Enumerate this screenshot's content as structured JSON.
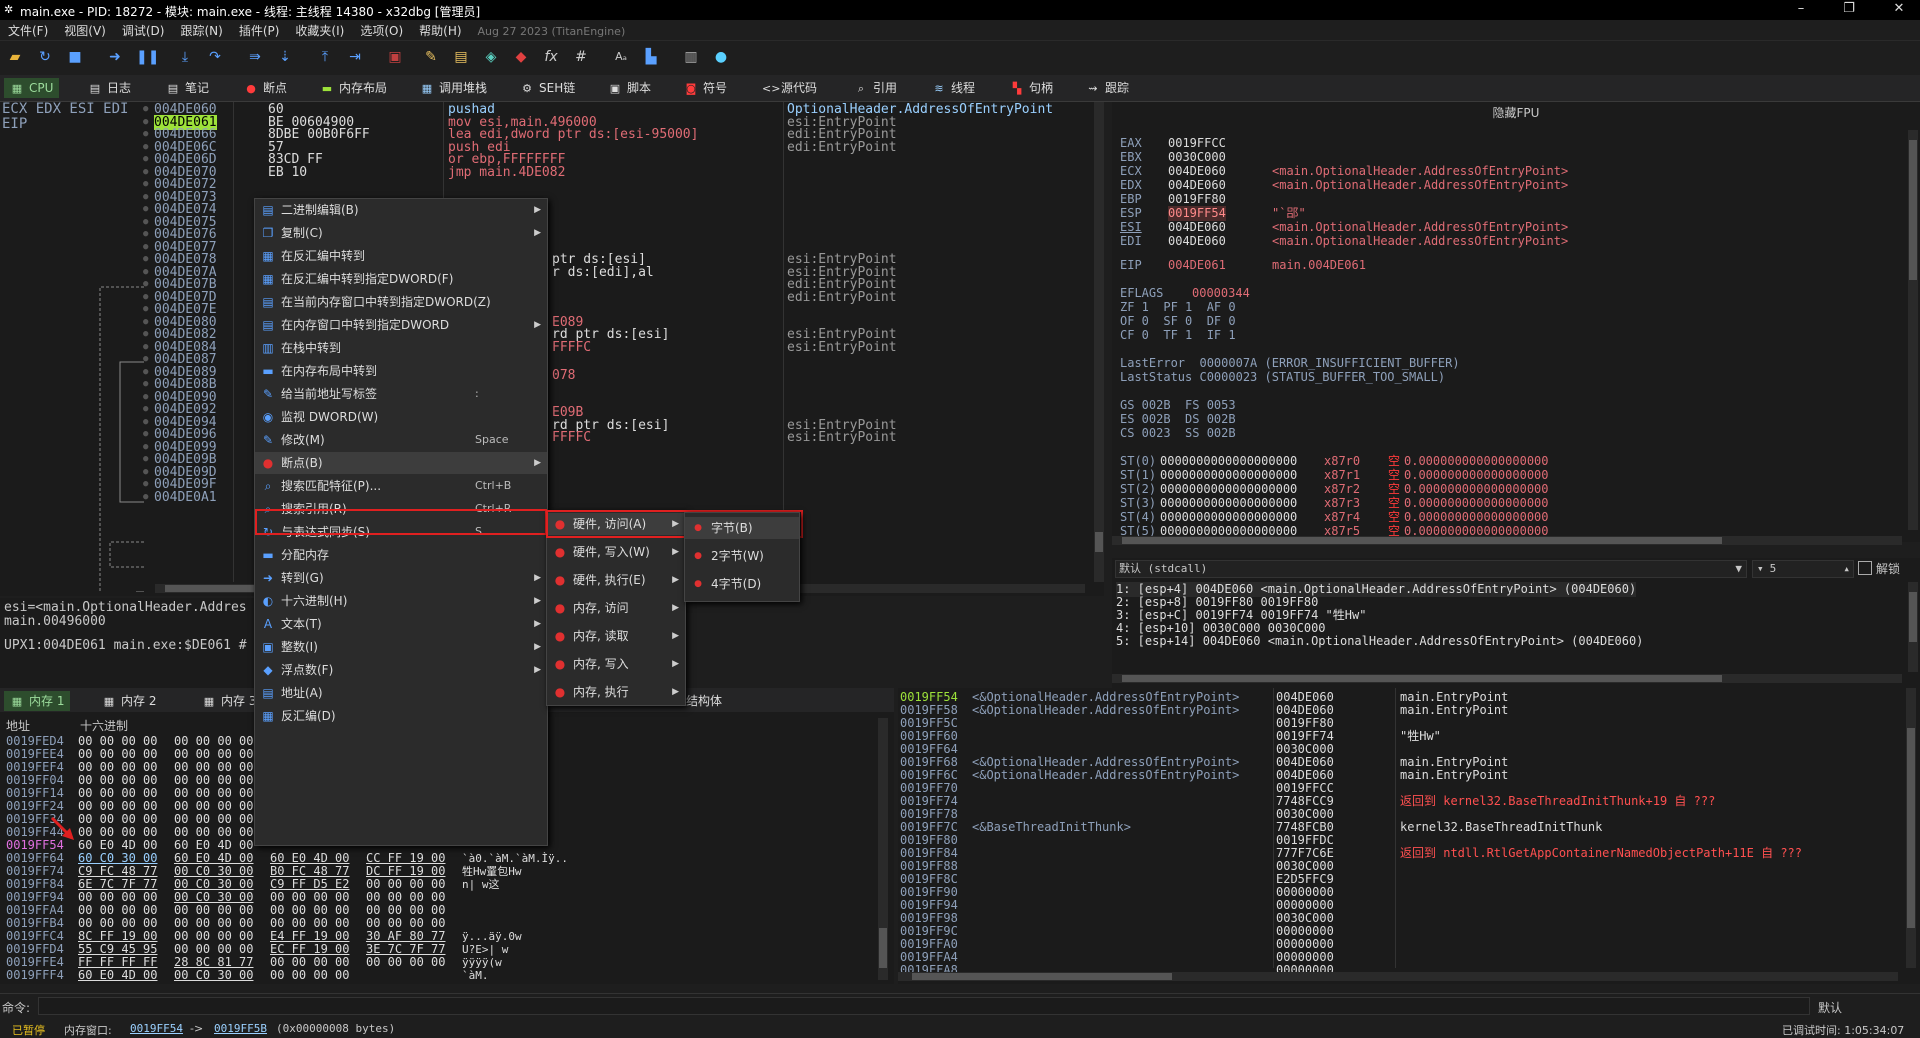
{
  "window": {
    "title": "main.exe - PID: 18272 - 模块: main.exe - 线程: 主线程 14380 - x32dbg [管理员]",
    "minimize": "–",
    "restore": "❐",
    "close": "✕"
  },
  "menubar": {
    "items": [
      "文件(F)",
      "视图(V)",
      "调试(D)",
      "跟踪(N)",
      "插件(P)",
      "收藏夹(I)",
      "选项(O)",
      "帮助(H)"
    ],
    "build_date": "Aug 27 2023 (TitanEngine)"
  },
  "tabs": [
    {
      "label": "CPU",
      "icon": "cpu-icon"
    },
    {
      "label": "日志",
      "icon": "log-icon"
    },
    {
      "label": "笔记",
      "icon": "notes-icon"
    },
    {
      "label": "断点",
      "icon": "breakpoint-icon"
    },
    {
      "label": "内存布局",
      "icon": "memory-map-icon"
    },
    {
      "label": "调用堆栈",
      "icon": "call-stack-icon"
    },
    {
      "label": "SEH链",
      "icon": "seh-icon"
    },
    {
      "label": "脚本",
      "icon": "script-icon"
    },
    {
      "label": "符号",
      "icon": "symbol-icon"
    },
    {
      "label": "源代码",
      "icon": "source-icon"
    },
    {
      "label": "引用",
      "icon": "references-icon"
    },
    {
      "label": "线程",
      "icon": "threads-icon"
    },
    {
      "label": "句柄",
      "icon": "handles-icon"
    },
    {
      "label": "跟踪",
      "icon": "trace-icon"
    }
  ],
  "disasm": {
    "reg_labels_top": "ECX EDX ESI EDI",
    "reg_label_eip": "EIP",
    "rows": [
      {
        "addr": "004DE060",
        "bytes": "60",
        "instr": "pushad",
        "comment": "OptionalHeader.AddressOfEntryPoint"
      },
      {
        "addr": "004DE061",
        "bytes": "BE 00604900",
        "instr": "mov esi,main.496000",
        "comment": "esi:EntryPoint"
      },
      {
        "addr": "004DE066",
        "bytes": "8DBE 00B0F6FF",
        "instr": "lea edi,dword ptr ds:[esi-95000]",
        "comment": "edi:EntryPoint"
      },
      {
        "addr": "004DE06C",
        "bytes": "57",
        "instr": "push edi",
        "comment": "edi:EntryPoint"
      },
      {
        "addr": "004DE06D",
        "bytes": "83CD FF",
        "instr": "or ebp,FFFFFFFF",
        "comment": ""
      },
      {
        "addr": "004DE070",
        "bytes": "EB 10",
        "instr": "jmp main.4DE082",
        "comment": ""
      }
    ],
    "more_addrs": [
      "004DE072",
      "004DE073",
      "004DE074",
      "004DE075",
      "004DE076",
      "004DE077",
      "004DE078",
      "004DE07A",
      "004DE07B",
      "004DE07D",
      "004DE07E",
      "004DE080",
      "004DE082",
      "004DE084",
      "004DE087",
      "004DE089",
      "004DE08B",
      "004DE090",
      "004DE092",
      "004DE094",
      "004DE096",
      "004DE099",
      "004DE09B",
      "004DE09D",
      "004DE09F",
      "004DE0A1"
    ],
    "partial_instr": [
      {
        "row": 12,
        "text": "ptr ds:[esi]",
        "comment": "esi:EntryPoint"
      },
      {
        "row": 13,
        "text": "r ds:[edi],al",
        "comment": "esi:EntryPoint"
      },
      {
        "row": 14,
        "text": "",
        "comment": "edi:EntryPoint"
      },
      {
        "row": 15,
        "text": "",
        "comment": "edi:EntryPoint"
      },
      {
        "row": 17,
        "text": "E089",
        "comment": ""
      },
      {
        "row": 18,
        "text": "rd ptr ds:[esi]",
        "comment": "esi:EntryPoint"
      },
      {
        "row": 19,
        "text": "FFFFC",
        "comment": "esi:EntryPoint"
      },
      {
        "row": 21,
        "text": "078",
        "comment": ""
      },
      {
        "row": 24,
        "text": "E09B",
        "comment": ""
      },
      {
        "row": 25,
        "text": "rd ptr ds:[esi]",
        "comment": "esi:EntryPoint"
      },
      {
        "row": 26,
        "text": "FFFFC",
        "comment": "esi:EntryPoint"
      }
    ]
  },
  "info_pane": {
    "line1": "esi=<main.OptionalHeader.Addres",
    "line2": "main.00496000",
    "line3": "UPX1:004DE061 main.exe:$DE061 #"
  },
  "registers": {
    "title": "隐藏FPU",
    "rows": [
      {
        "name": "EAX",
        "value": "0019FFCC",
        "comment": ""
      },
      {
        "name": "EBX",
        "value": "0030C000",
        "comment": ""
      },
      {
        "name": "ECX",
        "value": "004DE060",
        "comment": "<main.OptionalHeader.AddressOfEntryPoint>"
      },
      {
        "name": "EDX",
        "value": "004DE060",
        "comment": "<main.OptionalHeader.AddressOfEntryPoint>"
      },
      {
        "name": "EBP",
        "value": "0019FF80",
        "comment": ""
      },
      {
        "name": "ESP",
        "value": "0019FF54",
        "comment": "\"`郘\""
      },
      {
        "name": "ESI",
        "value": "004DE060",
        "comment": "<main.OptionalHeader.AddressOfEntryPoint>"
      },
      {
        "name": "EDI",
        "value": "004DE060",
        "comment": "<main.OptionalHeader.AddressOfEntryPoint>"
      }
    ],
    "eip": {
      "name": "EIP",
      "value": "004DE061",
      "comment": "main.004DE061"
    },
    "eflags": {
      "name": "EFLAGS",
      "value": "00000344"
    },
    "flags_lines": [
      "ZF 1  PF 1  AF 0",
      "OF 0  SF 0  DF 0",
      "CF 0  TF 1  IF 1"
    ],
    "last_error": "LastError  0000007A (ERROR_INSUFFICIENT_BUFFER)",
    "last_status": "LastStatus C0000023 (STATUS_BUFFER_TOO_SMALL)",
    "seg_lines": [
      "GS 002B  FS 0053",
      "ES 002B  DS 002B",
      "CS 0023  SS 002B"
    ],
    "fpu": [
      {
        "name": "ST(0)",
        "value": "0000000000000000000",
        "x87": "x87r0",
        "tag": "空",
        "val": "0.000000000000000000"
      },
      {
        "name": "ST(1)",
        "value": "0000000000000000000",
        "x87": "x87r1",
        "tag": "空",
        "val": "0.000000000000000000"
      },
      {
        "name": "ST(2)",
        "value": "0000000000000000000",
        "x87": "x87r2",
        "tag": "空",
        "val": "0.000000000000000000"
      },
      {
        "name": "ST(3)",
        "value": "0000000000000000000",
        "x87": "x87r3",
        "tag": "空",
        "val": "0.000000000000000000"
      },
      {
        "name": "ST(4)",
        "value": "0000000000000000000",
        "x87": "x87r4",
        "tag": "空",
        "val": "0.000000000000000000"
      },
      {
        "name": "ST(5)",
        "value": "0000000000000000000",
        "x87": "x87r5",
        "tag": "空",
        "val": "0.000000000000000000"
      }
    ]
  },
  "callconv": {
    "select": "默认 (stdcall)",
    "count": "5",
    "unlock_label": "解锁",
    "rows": [
      "1: [esp+4] 004DE060 <main.OptionalHeader.AddressOfEntryPoint> (004DE060)",
      "2: [esp+8] 0019FF80 0019FF80",
      "3: [esp+C] 0019FF74 0019FF74 \"牲Hw\"",
      "4: [esp+10] 0030C000 0030C000",
      "5: [esp+14] 004DE060 <main.OptionalHeader.AddressOfEntryPoint> (004DE060)"
    ]
  },
  "dump": {
    "tabs": [
      "内存 1",
      "内存 2",
      "内存 3"
    ],
    "struct_tab": "结构体",
    "col_addr": "地址",
    "col_hex": "十六进制",
    "rows": [
      {
        "addr": "0019FED4",
        "h1": "00 00 00 00",
        "h2": "00 00 00 00"
      },
      {
        "addr": "0019FEE4",
        "h1": "00 00 00 00",
        "h2": "00 00 00 00"
      },
      {
        "addr": "0019FEF4",
        "h1": "00 00 00 00",
        "h2": "00 00 00 00"
      },
      {
        "addr": "0019FF04",
        "h1": "00 00 00 00",
        "h2": "00 00 00 00"
      },
      {
        "addr": "0019FF14",
        "h1": "00 00 00 00",
        "h2": "00 00 00 00"
      },
      {
        "addr": "0019FF24",
        "h1": "00 00 00 00",
        "h2": "00 00 00 00"
      },
      {
        "addr": "0019FF34",
        "h1": "00 00 00 00",
        "h2": "00 00 00 00"
      },
      {
        "addr": "0019FF44",
        "h1": "00 00 00 00",
        "h2": "00 00 00 00"
      },
      {
        "addr": "0019FF54",
        "h1": "60 E0 4D 00",
        "h2": "60 E0 4D 00",
        "h3": "",
        "h4": "",
        "ascii": ""
      },
      {
        "addr": "0019FF64",
        "h1": "60 C0 30 00",
        "h2": "60 E0 4D 00",
        "h3": "60 E0 4D 00",
        "h4": "CC FF 19 00",
        "ascii": "`à0.`àM.`àM.Ìÿ.."
      },
      {
        "addr": "0019FF74",
        "h1": "C9 FC 48 77",
        "h2": "00 C0 30 00",
        "h3": "B0 FC 48 77",
        "h4": "DC FF 19 00",
        "ascii": "牲Hw罿包Hw"
      },
      {
        "addr": "0019FF84",
        "h1": "6E 7C 7F 77",
        "h2": "00 C0 30 00",
        "h3": "C9 FF D5 E2",
        "h4": "00 00 00 00",
        "ascii": "n| w这"
      },
      {
        "addr": "0019FF94",
        "h1": "00 00 00 00",
        "h2": "00 C0 30 00",
        "h3": "00 00 00 00",
        "h4": "00 00 00 00",
        "ascii": ""
      },
      {
        "addr": "0019FFA4",
        "h1": "00 00 00 00",
        "h2": "00 00 00 00",
        "h3": "00 00 00 00",
        "h4": "00 00 00 00",
        "ascii": ""
      },
      {
        "addr": "0019FFB4",
        "h1": "00 00 00 00",
        "h2": "00 00 00 00",
        "h3": "00 00 00 00",
        "h4": "00 00 00 00",
        "ascii": ""
      },
      {
        "addr": "0019FFC4",
        "h1": "8C FF 19 00",
        "h2": "00 00 00 00",
        "h3": "E4 FF 19 00",
        "h4": "30 AF 80 77",
        "ascii": "ÿ...äÿ.0w"
      },
      {
        "addr": "0019FFD4",
        "h1": "55 C9 45 95",
        "h2": "00 00 00 00",
        "h3": "EC FF 19 00",
        "h4": "3E 7C 7F 77",
        "ascii": "U?E>| w"
      },
      {
        "addr": "0019FFE4",
        "h1": "FF FF FF FF",
        "h2": "28 8C 81 77",
        "h3": "00 00 00 00",
        "h4": "00 00 00 00",
        "ascii": "ÿÿÿÿ(w"
      },
      {
        "addr": "0019FFF4",
        "h1": "60 E0 4D 00",
        "h2": "00 C0 30 00",
        "h3": "00 00 00 00",
        "h4": "",
        "ascii": "`àM."
      }
    ]
  },
  "stack": {
    "rows": [
      {
        "addr": "0019FF54",
        "sym": "<&OptionalHeader.AddressOfEntryPoint>",
        "val": "004DE060",
        "comment": "main.EntryPoint",
        "hl": true
      },
      {
        "addr": "0019FF58",
        "sym": "<&OptionalHeader.AddressOfEntryPoint>",
        "val": "004DE060",
        "comment": "main.EntryPoint"
      },
      {
        "addr": "0019FF5C",
        "sym": "",
        "val": "0019FF80",
        "comment": ""
      },
      {
        "addr": "0019FF60",
        "sym": "",
        "val": "0019FF74",
        "comment": "\"牲Hw\""
      },
      {
        "addr": "0019FF64",
        "sym": "",
        "val": "0030C000",
        "comment": ""
      },
      {
        "addr": "0019FF68",
        "sym": "<&OptionalHeader.AddressOfEntryPoint>",
        "val": "004DE060",
        "comment": "main.EntryPoint"
      },
      {
        "addr": "0019FF6C",
        "sym": "<&OptionalHeader.AddressOfEntryPoint>",
        "val": "004DE060",
        "comment": "main.EntryPoint"
      },
      {
        "addr": "0019FF70",
        "sym": "",
        "val": "0019FFCC",
        "comment": ""
      },
      {
        "addr": "0019FF74",
        "sym": "",
        "val": "7748FCC9",
        "comment": "返回到 kernel32.BaseThreadInitThunk+19 自 ???",
        "red": true
      },
      {
        "addr": "0019FF78",
        "sym": "",
        "val": "0030C000",
        "comment": ""
      },
      {
        "addr": "0019FF7C",
        "sym": "<&BaseThreadInitThunk>",
        "val": "7748FCB0",
        "comment": "kernel32.BaseThreadInitThunk"
      },
      {
        "addr": "0019FF80",
        "sym": "",
        "val": "0019FFDC",
        "comment": ""
      },
      {
        "addr": "0019FF84",
        "sym": "",
        "val": "777F7C6E",
        "comment": "返回到 ntdll.RtlGetAppContainerNamedObjectPath+11E 自 ???",
        "red": true
      },
      {
        "addr": "0019FF88",
        "sym": "",
        "val": "0030C000",
        "comment": ""
      },
      {
        "addr": "0019FF8C",
        "sym": "",
        "val": "E2D5FFC9",
        "comment": ""
      },
      {
        "addr": "0019FF90",
        "sym": "",
        "val": "00000000",
        "comment": ""
      },
      {
        "addr": "0019FF94",
        "sym": "",
        "val": "00000000",
        "comment": ""
      },
      {
        "addr": "0019FF98",
        "sym": "",
        "val": "0030C000",
        "comment": ""
      },
      {
        "addr": "0019FF9C",
        "sym": "",
        "val": "00000000",
        "comment": ""
      },
      {
        "addr": "0019FFA0",
        "sym": "",
        "val": "00000000",
        "comment": ""
      },
      {
        "addr": "0019FFA4",
        "sym": "",
        "val": "00000000",
        "comment": ""
      },
      {
        "addr": "0019FFA8",
        "sym": "",
        "val": "00000000",
        "comment": ""
      }
    ]
  },
  "context_menu": {
    "items": [
      {
        "label": "二进制编辑(B)",
        "shortcut": "",
        "sub": true,
        "icon": "binary-edit-icon"
      },
      {
        "label": "复制(C)",
        "shortcut": "",
        "sub": true,
        "icon": "copy-icon"
      },
      {
        "label": "在反汇编中转到",
        "shortcut": "",
        "sub": false,
        "icon": "goto-disasm-icon"
      },
      {
        "label": "在反汇编中转到指定DWORD(F)",
        "shortcut": "",
        "sub": false,
        "icon": "goto-disasm-dword-icon"
      },
      {
        "label": "在当前内存窗口中转到指定DWORD(Z)",
        "shortcut": "",
        "sub": false,
        "icon": "goto-dump-dword-icon"
      },
      {
        "label": "在内存窗口中转到指定DWORD",
        "shortcut": "",
        "sub": true,
        "icon": "goto-dump-window-icon"
      },
      {
        "label": "在栈中转到",
        "shortcut": "",
        "sub": false,
        "icon": "goto-stack-icon"
      },
      {
        "label": "在内存布局中转到",
        "shortcut": "",
        "sub": false,
        "icon": "goto-memmap-icon"
      },
      {
        "label": "给当前地址写标签",
        "shortcut": ":",
        "sub": false,
        "icon": "label-icon"
      },
      {
        "label": "监视 DWORD(W)",
        "shortcut": "",
        "sub": false,
        "icon": "watch-icon"
      },
      {
        "label": "修改(M)",
        "shortcut": "Space",
        "sub": false,
        "icon": "modify-icon"
      },
      {
        "label": "断点(B)",
        "shortcut": "",
        "sub": true,
        "icon": "breakpoint-icon"
      },
      {
        "label": "搜索匹配特征(P)...",
        "shortcut": "Ctrl+B",
        "sub": false,
        "icon": "search-pattern-icon"
      },
      {
        "label": "搜索引用(R)",
        "shortcut": "Ctrl+R",
        "sub": false,
        "icon": "find-references-icon"
      },
      {
        "label": "与表达式同步(S)",
        "shortcut": "S",
        "sub": false,
        "icon": "sync-icon"
      },
      {
        "label": "分配内存",
        "shortcut": "",
        "sub": false,
        "icon": "alloc-icon"
      },
      {
        "label": "转到(G)",
        "shortcut": "",
        "sub": true,
        "icon": "goto-icon"
      },
      {
        "label": "十六进制(H)",
        "shortcut": "",
        "sub": true,
        "icon": "hex-icon"
      },
      {
        "label": "文本(T)",
        "shortcut": "",
        "sub": true,
        "icon": "text-icon"
      },
      {
        "label": "整数(I)",
        "shortcut": "",
        "sub": true,
        "icon": "integer-icon"
      },
      {
        "label": "浮点数(F)",
        "shortcut": "",
        "sub": true,
        "icon": "float-icon"
      },
      {
        "label": "地址(A)",
        "shortcut": "",
        "sub": false,
        "icon": "address-icon"
      },
      {
        "label": "反汇编(D)",
        "shortcut": "",
        "sub": false,
        "icon": "disassembly-icon"
      }
    ],
    "bp_submenu": [
      {
        "label": "硬件, 访问(A)",
        "icon": "hw-access-icon"
      },
      {
        "label": "硬件, 写入(W)",
        "icon": "hw-write-icon"
      },
      {
        "label": "硬件, 执行(E)",
        "icon": "hw-exec-icon"
      },
      {
        "label": "内存, 访问",
        "icon": "mem-access-icon"
      },
      {
        "label": "内存, 读取",
        "icon": "mem-read-icon"
      },
      {
        "label": "内存, 写入",
        "icon": "mem-write-icon"
      },
      {
        "label": "内存, 执行",
        "icon": "mem-exec-icon"
      }
    ],
    "size_submenu": [
      {
        "label": "字节(B)"
      },
      {
        "label": "2字节(W)"
      },
      {
        "label": "4字节(D)"
      }
    ]
  },
  "command": {
    "label": "命令:",
    "placeholder": "",
    "default_label": "默认"
  },
  "status": {
    "state": "已暂停",
    "dump_prefix": "内存窗口:",
    "from": "0019FF54",
    "arrow": "->",
    "to": "0019FF5B",
    "size": "(0x00000008 bytes)",
    "elapsed": "已调试时间: 1:05:34:07"
  }
}
